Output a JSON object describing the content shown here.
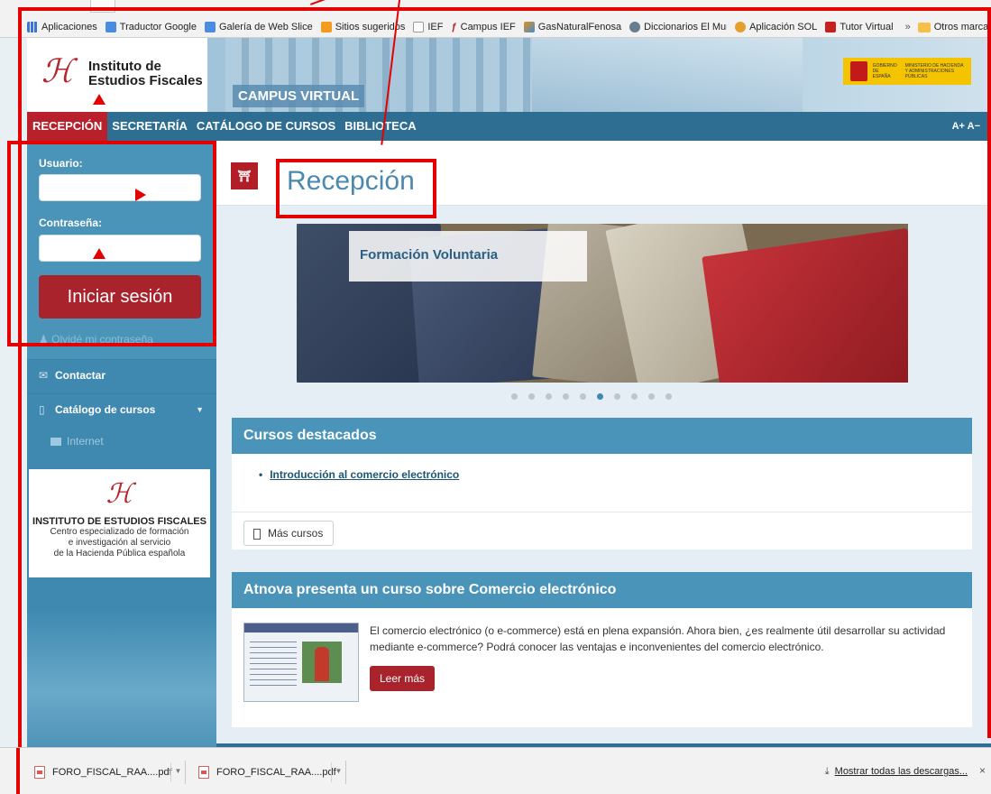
{
  "bookmarks": {
    "items": [
      {
        "label": "Aplicaciones",
        "icon": "apps-grid-icon"
      },
      {
        "label": "Traductor Google",
        "icon": "translate-icon"
      },
      {
        "label": "Galería de Web Slice",
        "icon": "web-slice-icon"
      },
      {
        "label": "Sitios sugeridos",
        "icon": "suggested-sites-icon"
      },
      {
        "label": "IEF",
        "icon": "document-icon"
      },
      {
        "label": "Campus IEF",
        "icon": "ief-logo-icon"
      },
      {
        "label": "GasNaturalFenosa",
        "icon": "gas-natural-icon"
      },
      {
        "label": "Diccionarios El Mundo",
        "icon": "globe-icon"
      },
      {
        "label": "Aplicación SOL",
        "icon": "user-icon"
      },
      {
        "label": "Tutor Virtual",
        "icon": "tutor-icon"
      }
    ],
    "more": "»",
    "other": "Otros marcadores"
  },
  "header": {
    "org_line1": "Instituto de",
    "org_line2": "Estudios Fiscales",
    "campus": "CAMPUS VIRTUAL",
    "gov_line1": "GOBIERNO DE ESPAÑA",
    "gov_line2": "MINISTERIO DE HACIENDA Y ADMINISTRACIONES PÚBLICAS"
  },
  "nav": {
    "items": [
      "RECEPCIÓN",
      "SECRETARÍA",
      "CATÁLOGO DE CURSOS",
      "BIBLIOTECA"
    ],
    "active_index": 0,
    "font_controls": "A+ A−"
  },
  "sidebar": {
    "user_label": "Usuario:",
    "user_value": "",
    "pass_label": "Contraseña:",
    "pass_value": "",
    "login_button": "Iniciar sesión",
    "forgot": "Olvidé mi contraseña",
    "contact": "Contactar",
    "catalog": "Catálogo de cursos",
    "sub_internet": "Internet",
    "card_title": "INSTITUTO DE ESTUDIOS FISCALES",
    "card_l1": "Centro especializado de formación",
    "card_l2": "e investigación al servicio",
    "card_l3": "de la Hacienda Pública española"
  },
  "main": {
    "title": "Recepción",
    "banner_title": "Formación Voluntaria",
    "carousel_count": 10,
    "carousel_active": 5,
    "featured_title": "Cursos destacados",
    "featured_link": "Introducción al comercio electrónico",
    "more_courses": "Más cursos",
    "news_title": "Atnova presenta un curso sobre Comercio electrónico",
    "news_text": "El comercio electrónico (o e-commerce) está en plena expansión. Ahora bien, ¿es realmente útil desarrollar su actividad mediante e-commerce? Podrá conocer las ventajas e inconvenientes del comercio electrónico.",
    "read_more": "Leer más"
  },
  "downloads": {
    "items": [
      "FORO_FISCAL_RAA....pdf",
      "FORO_FISCAL_RAA....pdf"
    ],
    "show_all": "Mostrar todas las descargas...",
    "close": "×"
  },
  "colors": {
    "nav": "#2f6e93",
    "active": "#b8212b",
    "sidebar": "#3f89b0",
    "annotation": "#e40000"
  }
}
